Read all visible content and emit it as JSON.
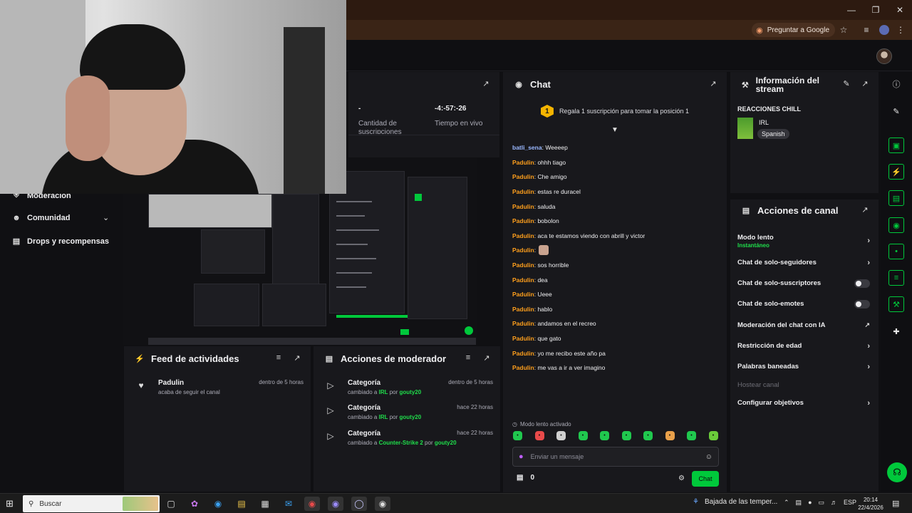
{
  "browser": {
    "ask_google": "Preguntar a Google",
    "window_controls": [
      "minimize-icon",
      "maximize-icon",
      "close-icon"
    ]
  },
  "left_nav": {
    "items": [
      {
        "label": "Moderación",
        "icon": "shield-icon"
      },
      {
        "label": "Comunidad",
        "icon": "people-icon",
        "expandable": true
      },
      {
        "label": "Drops y recompensas",
        "icon": "gift-icon"
      }
    ]
  },
  "stats": {
    "subs_value": "-",
    "subs_label": "Cantidad de suscripciones",
    "live_value": "-4:-57:-26",
    "live_label": "Tiempo en vivo"
  },
  "feed": {
    "title": "Feed de actividades",
    "events": [
      {
        "user": "Padulin",
        "text": "acaba de seguir el canal",
        "time": "dentro de 5 horas"
      }
    ]
  },
  "mod_actions": {
    "title": "Acciones de moderador",
    "events": [
      {
        "title": "Categoría",
        "prefix": "cambiado a ",
        "value": "IRL",
        "by": " por ",
        "user": "gouty20",
        "time": "dentro de 5 horas"
      },
      {
        "title": "Categoría",
        "prefix": "cambiado a ",
        "value": "IRL",
        "by": " por ",
        "user": "gouty20",
        "time": "hace 22 horas"
      },
      {
        "title": "Categoría",
        "prefix": "cambiado a ",
        "value": "Counter-Strike 2",
        "by": " por ",
        "user": "gouty20",
        "time": "hace 22 horas"
      }
    ]
  },
  "chat": {
    "title": "Chat",
    "pin_position": "1",
    "pin_text": "Regala 1 suscripción para tomar la posición 1",
    "messages": [
      {
        "user": "batli_sena",
        "color": "#9ab8ff",
        "text": "Weeeep"
      },
      {
        "user": "Padulin",
        "color": "#ff9f1c",
        "text": "ohhh tiago"
      },
      {
        "user": "Padulin",
        "color": "#ff9f1c",
        "text": "Che amigo"
      },
      {
        "user": "Padulin",
        "color": "#ff9f1c",
        "text": "estas re duracel"
      },
      {
        "user": "Padulin",
        "color": "#ff9f1c",
        "text": "saluda"
      },
      {
        "user": "Padulin",
        "color": "#ff9f1c",
        "text": "bobolon"
      },
      {
        "user": "Padulin",
        "color": "#ff9f1c",
        "text": "aca te estamos viendo con abrill y victor"
      },
      {
        "user": "Padulin",
        "color": "#ff9f1c",
        "text": "",
        "emote": true
      },
      {
        "user": "Padulin",
        "color": "#ff9f1c",
        "text": "sos horrible"
      },
      {
        "user": "Padulin",
        "color": "#ff9f1c",
        "text": "dea"
      },
      {
        "user": "Padulin",
        "color": "#ff9f1c",
        "text": "Ueee"
      },
      {
        "user": "Padulin",
        "color": "#ff9f1c",
        "text": "hablo"
      },
      {
        "user": "Padulin",
        "color": "#ff9f1c",
        "text": "andamos en el recreo"
      },
      {
        "user": "Padulin",
        "color": "#ff9f1c",
        "text": "que gato"
      },
      {
        "user": "Padulin",
        "color": "#ff9f1c",
        "text": "yo me recibo este año pa"
      },
      {
        "user": "Padulin",
        "color": "#ff9f1c",
        "text": "me vas a ir a ver imagino"
      }
    ],
    "slow_mode": "Modo lento activado",
    "input_placeholder": "Enviar un mensaje",
    "points": "0",
    "send_label": "Chat"
  },
  "stream_info": {
    "title": "Información del stream",
    "stream_title": "REACCIONES CHILL",
    "category": "IRL",
    "language": "Spanish"
  },
  "channel_actions": {
    "title": "Acciones de canal",
    "items": [
      {
        "label": "Modo lento",
        "sub": "Instantáneo",
        "control": "chevron"
      },
      {
        "label": "Chat de solo-seguidores",
        "control": "chevron"
      },
      {
        "label": "Chat de solo-suscriptores",
        "control": "toggle"
      },
      {
        "label": "Chat de solo-emotes",
        "control": "toggle"
      },
      {
        "label": "Moderación del chat con IA",
        "control": "external"
      },
      {
        "label": "Restricción de edad",
        "control": "chevron"
      },
      {
        "label": "Palabras baneadas",
        "control": "chevron"
      },
      {
        "label": "Hostear canal",
        "control": "none",
        "disabled": true
      },
      {
        "label": "Configurar objetivos",
        "control": "chevron"
      }
    ]
  },
  "taskbar": {
    "search_placeholder": "Buscar",
    "weather_text": "Bajada de las temper...",
    "lang": "ESP",
    "time": "20:14",
    "date": "22/4/2026"
  }
}
